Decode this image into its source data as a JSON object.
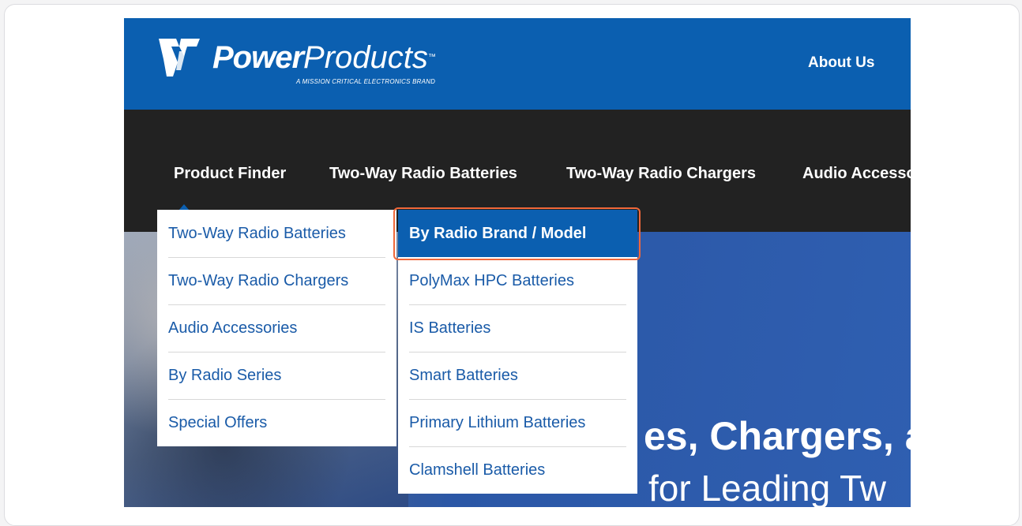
{
  "header": {
    "logo_power": "Power",
    "logo_products": "Products",
    "logo_tm": "™",
    "tagline": "A MISSION CRITICAL ELECTRONICS BRAND",
    "about_link": "About Us"
  },
  "nav": {
    "items": [
      {
        "label": "Product Finder"
      },
      {
        "label": "Two-Way Radio Batteries"
      },
      {
        "label": "Two-Way Radio Chargers"
      },
      {
        "label": "Audio Accesso"
      }
    ]
  },
  "menu_primary": {
    "items": [
      {
        "label": "Two-Way Radio Batteries"
      },
      {
        "label": "Two-Way Radio Chargers"
      },
      {
        "label": "Audio Accessories"
      },
      {
        "label": "By Radio Series"
      },
      {
        "label": "Special Offers"
      }
    ]
  },
  "menu_secondary": {
    "items": [
      {
        "label": "By Radio Brand / Model",
        "active": true
      },
      {
        "label": "PolyMax HPC Batteries"
      },
      {
        "label": "IS Batteries"
      },
      {
        "label": "Smart Batteries"
      },
      {
        "label": "Primary Lithium Batteries"
      },
      {
        "label": "Clamshell Batteries"
      }
    ]
  },
  "hero": {
    "line1": "es, Chargers, a",
    "line2": "for Leading Tw"
  },
  "colors": {
    "brand_blue": "#0b5fb0",
    "nav_dark": "#222222",
    "link_blue": "#1a5ba8",
    "highlight": "#f0683a"
  }
}
